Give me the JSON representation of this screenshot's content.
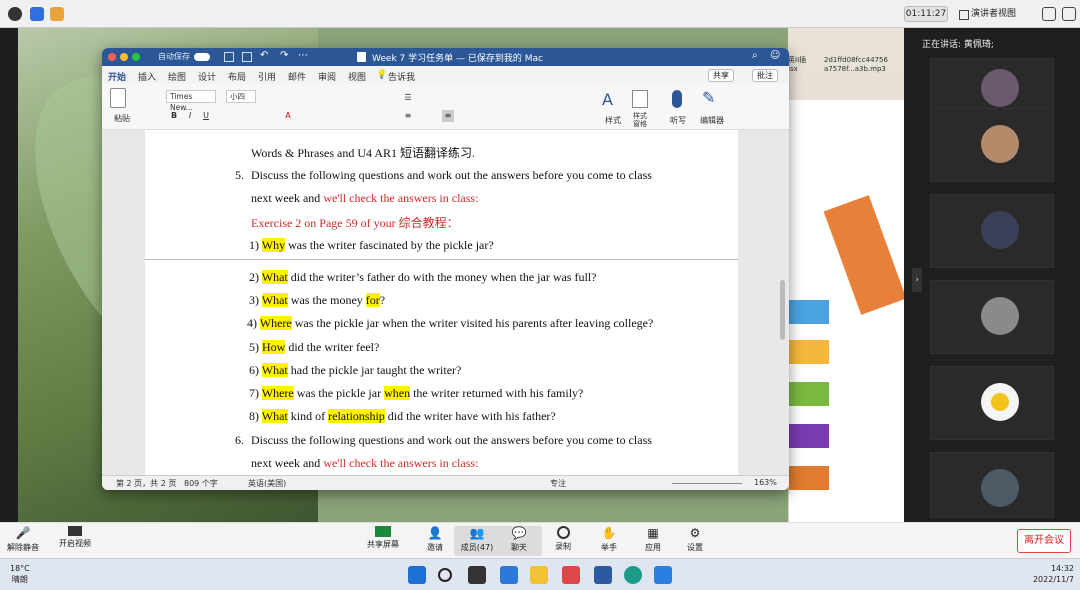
{
  "meeting": {
    "timer": "01:11:27",
    "view_label": "演讲者视图",
    "speaking_label": "正在讲话: 黄佩琦;",
    "leave_label": "离开会议",
    "toolbar": [
      {
        "label": "解除静音",
        "icon": "mic-muted-icon"
      },
      {
        "label": "开启视频",
        "icon": "camera-off-icon"
      },
      {
        "label": "共享屏幕",
        "icon": "share-screen-icon"
      },
      {
        "label": "邀请",
        "icon": "invite-icon"
      },
      {
        "label": "成员(47)",
        "icon": "members-icon"
      },
      {
        "label": "聊天",
        "icon": "chat-icon"
      },
      {
        "label": "录制",
        "icon": "record-icon"
      },
      {
        "label": "举手",
        "icon": "hand-icon"
      },
      {
        "label": "应用",
        "icon": "apps-icon"
      },
      {
        "label": "设置",
        "icon": "settings-icon"
      }
    ]
  },
  "desktop": {
    "file1": "2d1ffd08fcc44756\na7578f...a3b.mp3",
    "file2": "英II插\nisx"
  },
  "word": {
    "autosave": "自动保存",
    "title": "Week 7 学习任务单 — 已保存到我的 Mac",
    "tabs": [
      "开始",
      "插入",
      "绘图",
      "设计",
      "布局",
      "引用",
      "邮件",
      "审阅",
      "视图",
      "告诉我"
    ],
    "share_label": "共享",
    "comment_label": "批注",
    "font_name": "Times New...",
    "font_size": "小四",
    "paste_label": "粘贴",
    "styles_label": "样式",
    "styles_pane_label": "样式\n窗格",
    "dictate_label": "听写",
    "editor_label": "编辑器",
    "status_page": "第 2 页，共 2 页",
    "status_words": "809 个字",
    "status_lang": "英语(美国)",
    "status_focus": "专注",
    "status_zoom": "163%"
  },
  "document": {
    "line0": "Words & Phrases and U4 AR1  短语翻译练习.",
    "item5_num": "5.",
    "item5_a": "Discuss the following questions and work out the answers before you come to class",
    "item5_b1": "next week and ",
    "item5_b2": "we'll check the answers in class:",
    "exercise": "Exercise 2 on Page 59 of your  综合教程",
    "exercise_end": "：",
    "questions": [
      {
        "num": "1) ",
        "hl": "Why",
        "rest": " was the writer fascinated by the pickle jar?"
      },
      {
        "num": "2) ",
        "hl": "What",
        "rest": " did the writer’s father do with the money when the jar was full?"
      },
      {
        "num": "3) ",
        "hl": "What",
        "mid": " was the money ",
        "hl2": "for",
        "rest": "?"
      },
      {
        "num": "4) ",
        "hl": "Where",
        "rest": " was the pickle jar when the writer visited his parents after leaving college?"
      },
      {
        "num": "5) ",
        "hl": "How",
        "rest": " did the writer feel?"
      },
      {
        "num": "6) ",
        "hl": "What",
        "rest": " had the pickle jar taught the writer?"
      },
      {
        "num": "7) ",
        "hl": "Where",
        "mid": " was the pickle jar ",
        "hl2": "when",
        "rest": " the writer returned with his family?"
      },
      {
        "num": "8) ",
        "hl": "What",
        "mid": " kind of ",
        "hl2": "relationship",
        "rest": " did the writer have with his father?"
      }
    ],
    "item6_num": "6.",
    "item6_a": "Discuss the following questions and work out the answers before you come to class",
    "item6_b1": "next week and ",
    "item6_b2": "we'll check the answers in class:"
  },
  "taskbar": {
    "temp": "18°C",
    "weather": "晴朗",
    "time": "14:32",
    "date": "2022/11/7"
  },
  "colors": {
    "word_blue": "#2b5797",
    "highlight": "#fff200",
    "red_text": "#d12b2b",
    "leave_red": "#dd2222"
  }
}
